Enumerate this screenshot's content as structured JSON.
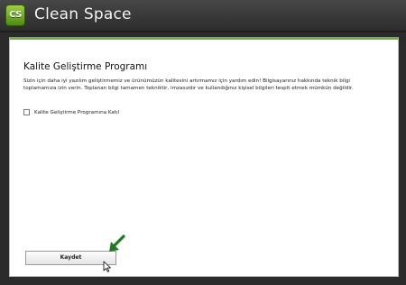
{
  "app": {
    "title": "Clean Space",
    "logo_text": "CS"
  },
  "section": {
    "heading": "Kalite Geliştirme Programı",
    "description": "Sizin için daha iyi yazılım geliştirmemiz ve ürünümüzün kalitesini artırmamız için yardım edin! Bilgisayarınız hakkında teknik bilgi toplamamıza izin verin. Toplanan bilgi tamamen tekniktir, imzasızdır ve kullandığınız kişisel bilgileri tespit etmek mümkün değildir.",
    "checkbox_label": "Kalite Geliştirme Programına Katıl",
    "checkbox_checked": false
  },
  "buttons": {
    "save_label": "Kaydet"
  },
  "icons": {
    "arrow": "arrow-down-left-icon",
    "cursor": "mouse-pointer-icon"
  },
  "colors": {
    "accent": "#6cb33f",
    "logo": "#7ab52a"
  }
}
